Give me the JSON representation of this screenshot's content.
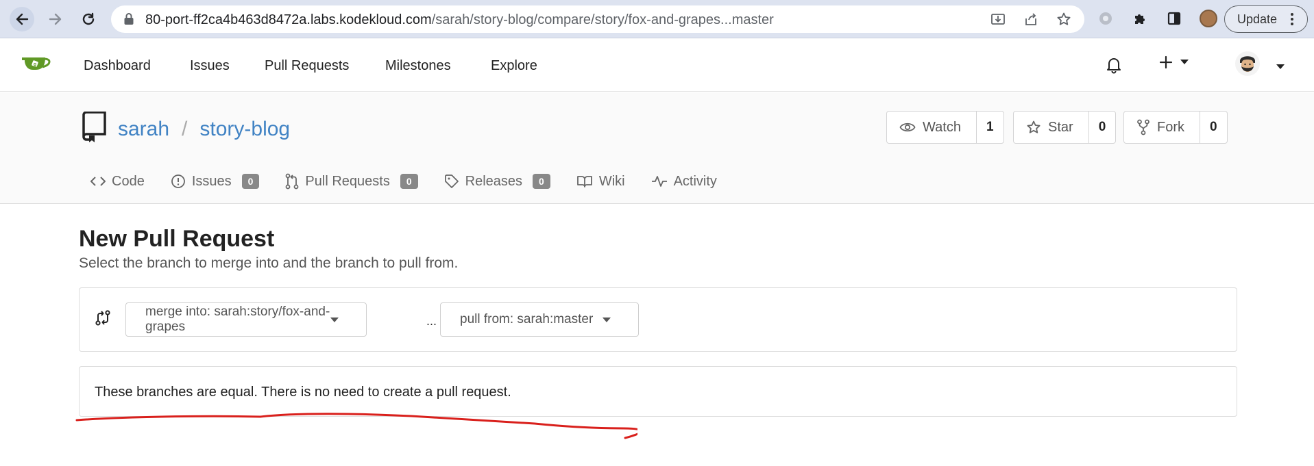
{
  "browser": {
    "url_host": "80-port-ff2ca4b463d8472a.labs.kodekloud.com",
    "url_path": "/sarah/story-blog/compare/story/fox-and-grapes...master",
    "update_label": "Update"
  },
  "nav": {
    "items": [
      "Dashboard",
      "Issues",
      "Pull Requests",
      "Milestones",
      "Explore"
    ]
  },
  "repo": {
    "owner": "sarah",
    "separator": "/",
    "name": "story-blog",
    "watch_label": "Watch",
    "watch_count": "1",
    "star_label": "Star",
    "star_count": "0",
    "fork_label": "Fork",
    "fork_count": "0"
  },
  "tabs": {
    "code": "Code",
    "issues": "Issues",
    "issues_count": "0",
    "pulls": "Pull Requests",
    "pulls_count": "0",
    "releases": "Releases",
    "releases_count": "0",
    "wiki": "Wiki",
    "activity": "Activity"
  },
  "page": {
    "title": "New Pull Request",
    "subtitle": "Select the branch to merge into and the branch to pull from.",
    "merge_into": "merge into: sarah:story/fox-and-grapes",
    "ellipsis": "...",
    "pull_from": "pull from: sarah:master",
    "message": "These branches are equal. There is no need to create a pull request."
  },
  "colors": {
    "link": "#4183c4",
    "annotation": "#d9201c",
    "logo": "#609926"
  }
}
